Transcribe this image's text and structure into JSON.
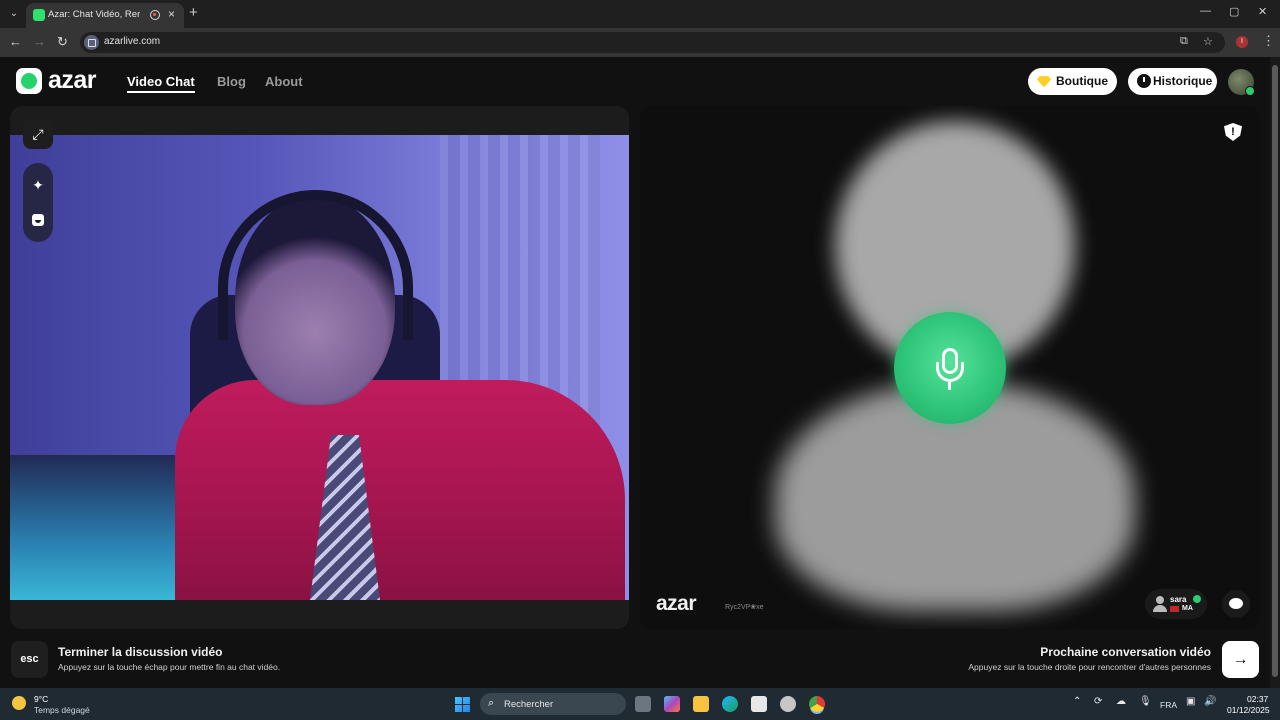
{
  "browser": {
    "tab_title": "Azar: Chat Vidéo, Rencontr",
    "url": "azarlive.com",
    "profile_initial": "I"
  },
  "site": {
    "logo": "azar",
    "nav": [
      "Video Chat",
      "Blog",
      "About"
    ],
    "boutique_label": "Boutique",
    "historique_label": "Historique",
    "accent_color": "#2ecc71"
  },
  "right_panel": {
    "watermark": "azar",
    "peer_id": "Ryc2VP❀xe",
    "peer_name": "sara",
    "peer_country": "MA"
  },
  "bottom": {
    "esc_key": "esc",
    "end_title": "Terminer la discussion vidéo",
    "end_hint": "Appuyez sur la touche échap pour mettre fin au chat vidéo.",
    "next_title": "Prochaine conversation vidéo",
    "next_hint": "Appuyez sur la touche droite pour rencontrer d'autres personnes"
  },
  "taskbar": {
    "temperature": "9°C",
    "weather": "Temps dégagé",
    "search_placeholder": "Rechercher",
    "language": "FRA",
    "time": "02:37",
    "date": "01/12/2025"
  }
}
